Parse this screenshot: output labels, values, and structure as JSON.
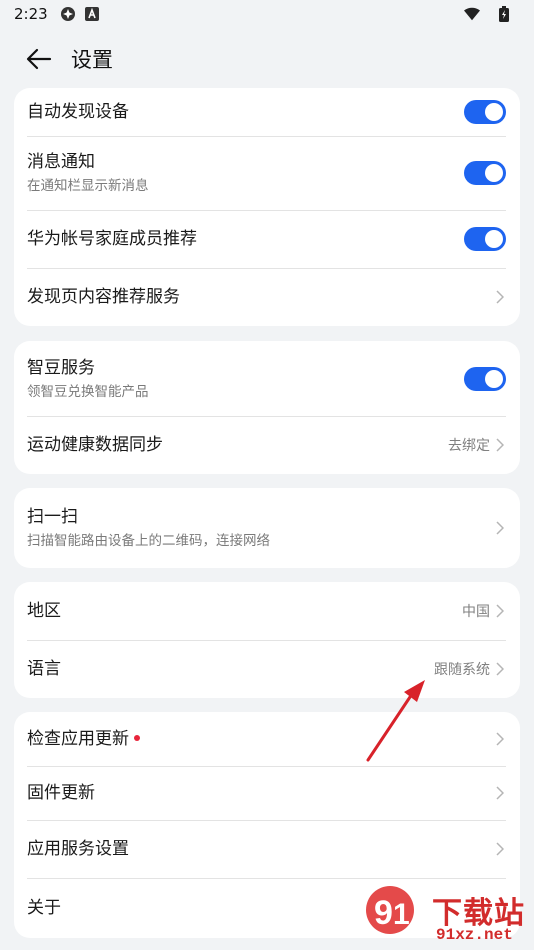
{
  "status": {
    "time": "2:23"
  },
  "header": {
    "title": "设置"
  },
  "cards": {
    "c1": {
      "auto_discover": {
        "label": "自动发现设备",
        "on": true
      },
      "notifications": {
        "label": "消息通知",
        "sub": "在通知栏显示新消息",
        "on": true
      },
      "family_recommend": {
        "label": "华为帐号家庭成员推荐",
        "on": true
      },
      "discover_recommend": {
        "label": "发现页内容推荐服务"
      }
    },
    "c2": {
      "zhidou": {
        "label": "智豆服务",
        "sub": "领智豆兑换智能产品",
        "on": true
      },
      "health_sync": {
        "label": "运动健康数据同步",
        "value": "去绑定"
      }
    },
    "c3": {
      "scan": {
        "label": "扫一扫",
        "sub": "扫描智能路由设备上的二维码，连接网络"
      }
    },
    "c4": {
      "region": {
        "label": "地区",
        "value": "中国"
      },
      "language": {
        "label": "语言",
        "value": "跟随系统"
      }
    },
    "c5": {
      "check_update": {
        "label": "检查应用更新"
      },
      "firmware": {
        "label": "固件更新"
      },
      "app_service": {
        "label": "应用服务设置"
      },
      "about": {
        "label": "关于"
      }
    }
  },
  "watermark": {
    "brand": "下载站",
    "domain": "91xz.net"
  },
  "colors": {
    "accent": "#1e64f0",
    "red_dot": "#e8243a",
    "annotation_arrow": "#d8222a"
  }
}
